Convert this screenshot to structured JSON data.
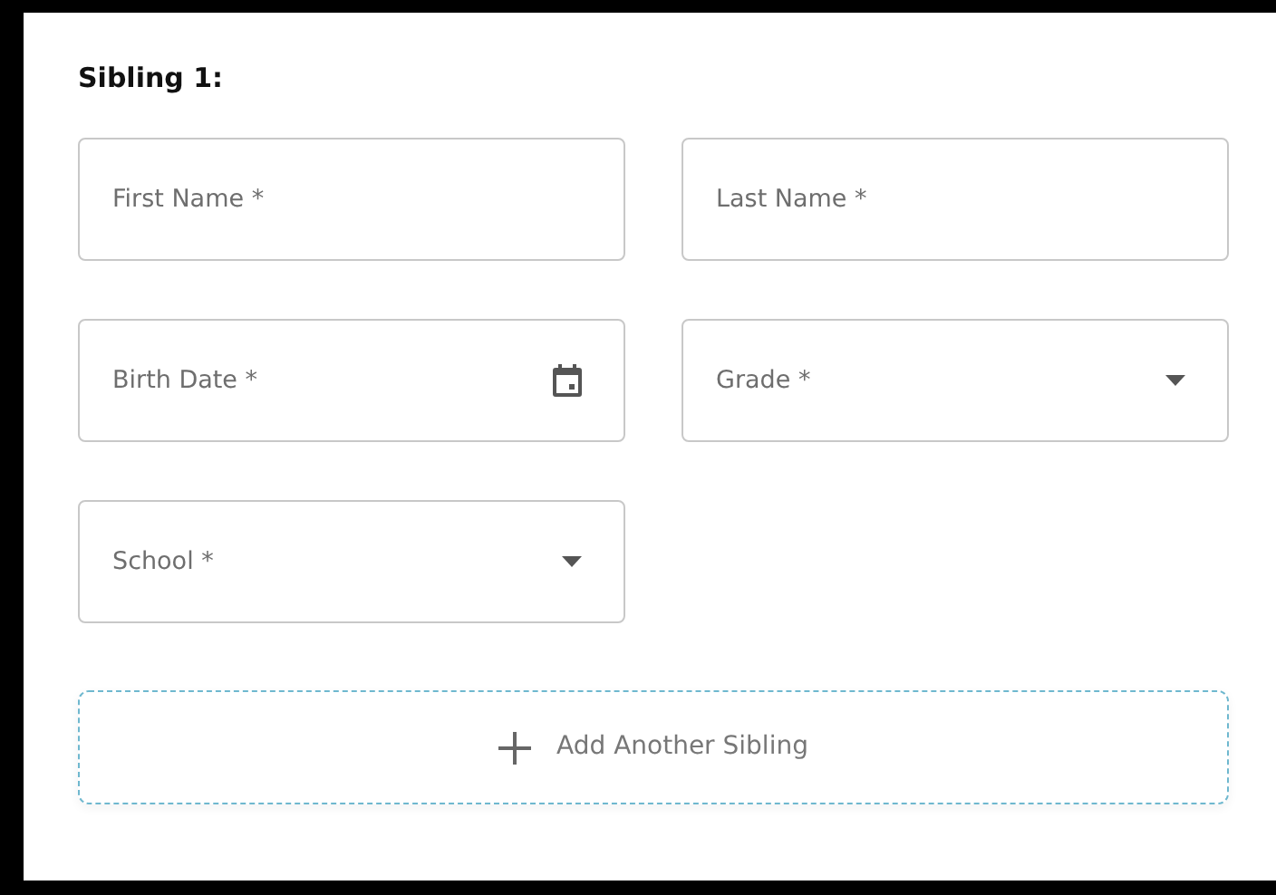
{
  "section_title": "Sibling 1:",
  "fields": [
    {
      "kind": "text",
      "placeholder": "First Name *"
    },
    {
      "kind": "text",
      "placeholder": "Last Name *"
    },
    {
      "kind": "date",
      "placeholder": "Birth Date *"
    },
    {
      "kind": "select",
      "placeholder": "Grade *"
    },
    {
      "kind": "select",
      "placeholder": "School *"
    }
  ],
  "add_button": {
    "label": "Add Another Sibling"
  }
}
